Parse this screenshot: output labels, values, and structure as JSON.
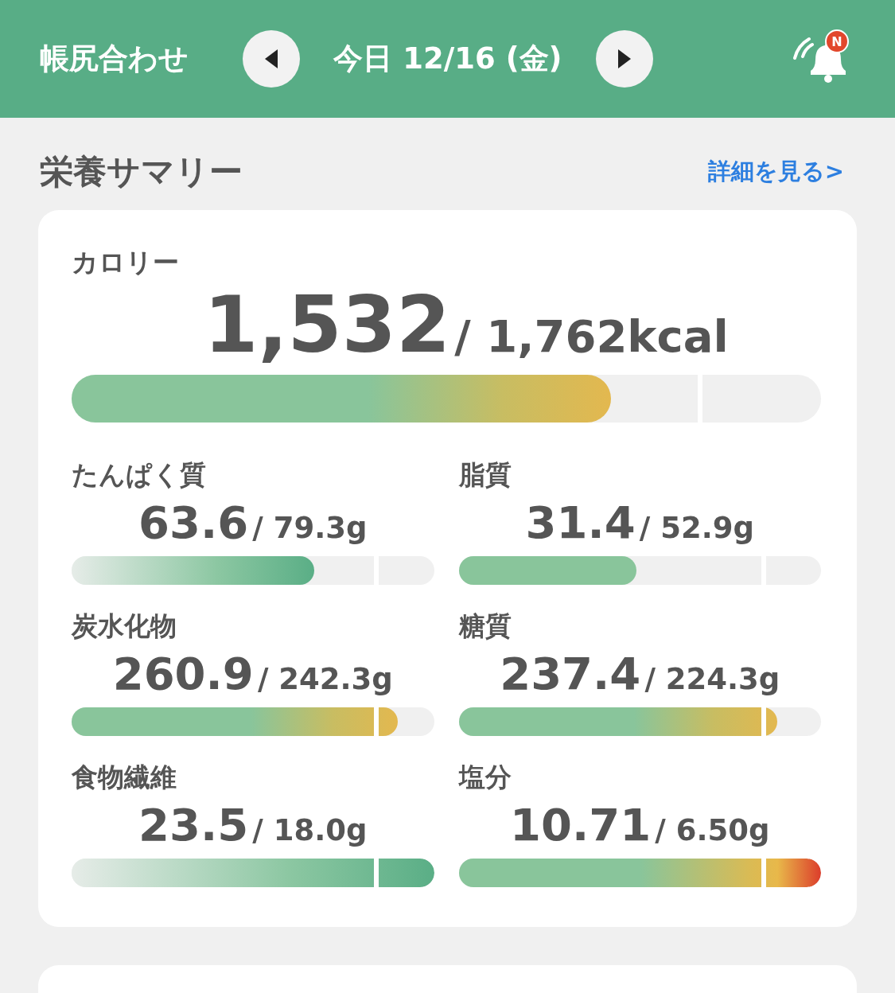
{
  "header": {
    "title": "帳尻合わせ",
    "date": "今日 12/16 (金)",
    "badge": "N"
  },
  "summary": {
    "title": "栄養サマリー",
    "link": "詳細を見る>"
  },
  "calorie": {
    "label": "カロリー",
    "value": "1,532",
    "target": "/ 1,762kcal",
    "level": 0.72,
    "kind": "warn"
  },
  "nutrients": [
    {
      "label": "たんぱく質",
      "value": "63.6",
      "target": "/ 79.3g",
      "level": 0.67,
      "kind": "fade"
    },
    {
      "label": "脂質",
      "value": "31.4",
      "target": "/ 52.9g",
      "level": 0.49,
      "kind": "solid"
    },
    {
      "label": "炭水化物",
      "value": "260.9",
      "target": "/ 242.3g",
      "level": 0.9,
      "kind": "warn"
    },
    {
      "label": "糖質",
      "value": "237.4",
      "target": "/ 224.3g",
      "level": 0.88,
      "kind": "warn"
    },
    {
      "label": "食物繊維",
      "value": "23.5",
      "target": "/ 18.0g",
      "level": 1,
      "kind": "fade"
    },
    {
      "label": "塩分",
      "value": "10.71",
      "target": "/ 6.50g",
      "level": 1,
      "kind": "alert"
    }
  ]
}
